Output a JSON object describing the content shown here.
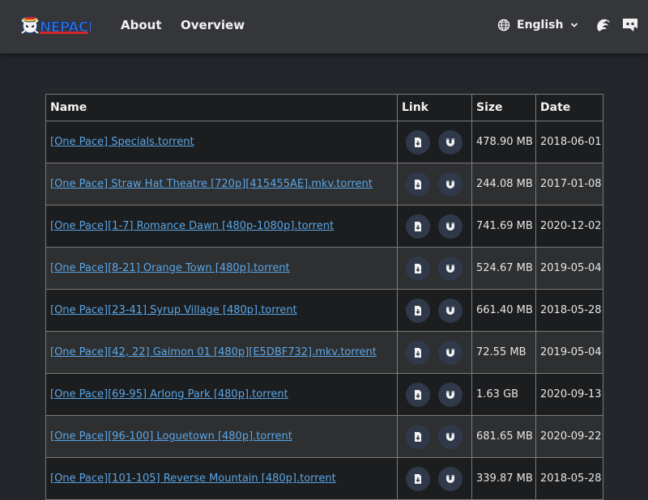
{
  "header": {
    "logo_text": "ONE PACE",
    "nav": {
      "about": "About",
      "overview": "Overview"
    },
    "language": {
      "label": "English",
      "icon": "globe-icon"
    },
    "icons": [
      "hydra-icon",
      "discord-icon"
    ]
  },
  "table": {
    "columns": {
      "name": "Name",
      "link": "Link",
      "size": "Size",
      "date": "Date"
    },
    "rows": [
      {
        "name": "[One Pace] Specials.torrent",
        "size": "478.90 MB",
        "date": "2018-06-01"
      },
      {
        "name": "[One Pace] Straw Hat Theatre [720p][415455AE].mkv.torrent",
        "size": "244.08 MB",
        "date": "2017-01-08"
      },
      {
        "name": "[One Pace][1-7] Romance Dawn [480p-1080p].torrent",
        "size": "741.69 MB",
        "date": "2020-12-02"
      },
      {
        "name": "[One Pace][8-21] Orange Town [480p].torrent",
        "size": "524.67 MB",
        "date": "2019-05-04"
      },
      {
        "name": "[One Pace][23-41] Syrup Village [480p].torrent",
        "size": "661.40 MB",
        "date": "2018-05-28"
      },
      {
        "name": "[One Pace][42, 22] Gaimon 01 [480p][E5DBF732].mkv.torrent",
        "size": "72.55 MB",
        "date": "2019-05-04"
      },
      {
        "name": "[One Pace][69-95] Arlong Park [480p].torrent",
        "size": "1.63 GB",
        "date": "2020-09-13"
      },
      {
        "name": "[One Pace][96-100] Loguetown [480p].torrent",
        "size": "681.65 MB",
        "date": "2020-09-22"
      },
      {
        "name": "[One Pace][101-105] Reverse Mountain [480p].torrent",
        "size": "339.87 MB",
        "date": "2018-05-28"
      }
    ],
    "link_icons": [
      "torrent-file-icon",
      "magnet-icon"
    ]
  },
  "colors": {
    "header_bg": "#35363a",
    "page_bg": "#23262b",
    "link": "#5aa6e6",
    "row_dark": "#1c1d1f",
    "row_light": "#2e2f31",
    "button_bg": "#30394a"
  }
}
